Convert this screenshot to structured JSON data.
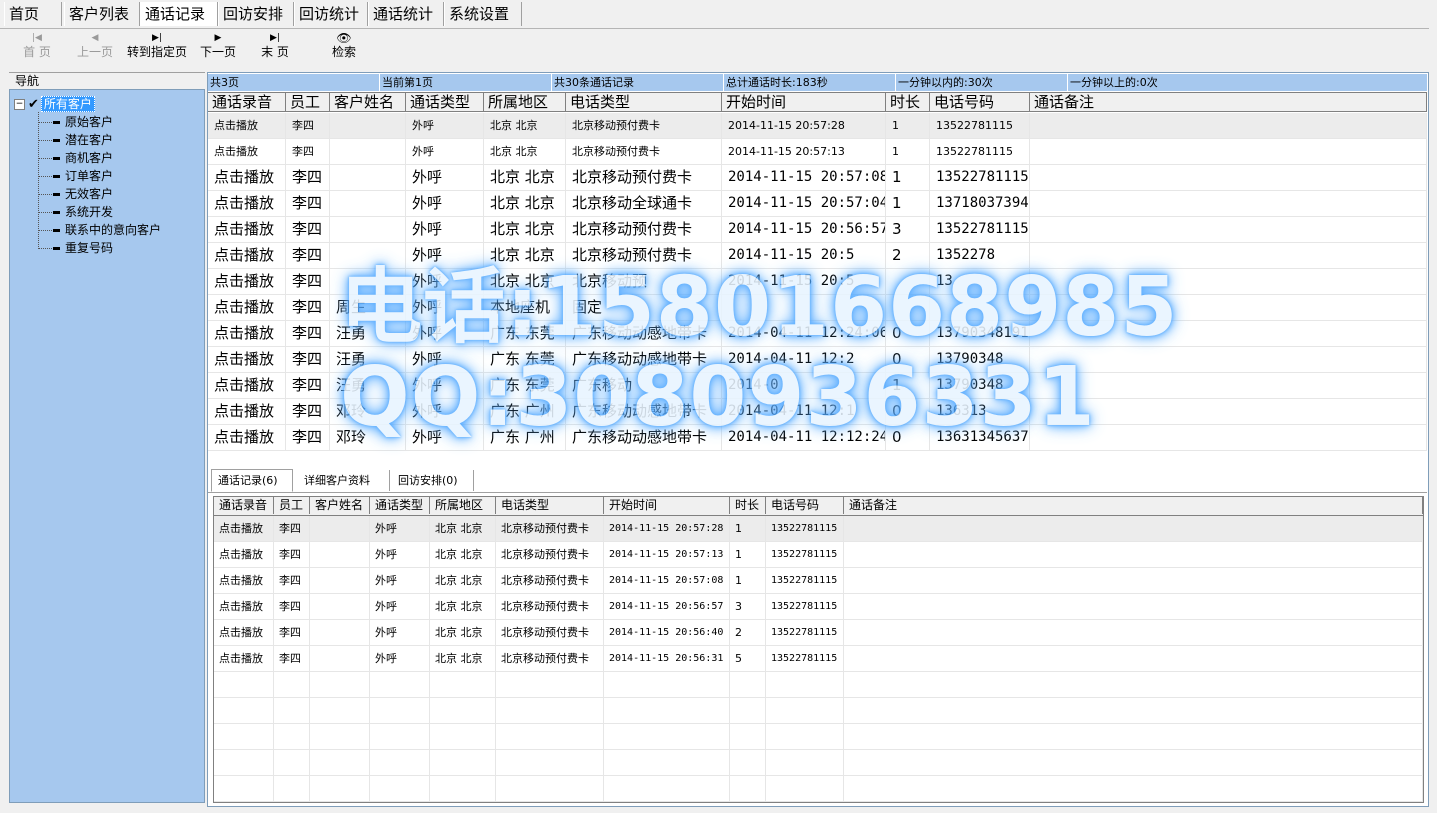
{
  "menu": {
    "tabs": [
      "首页",
      "客户列表",
      "通话记录",
      "回访安排",
      "回访统计",
      "通话统计",
      "系统设置"
    ]
  },
  "toolbar": {
    "first": "首  页",
    "prev": "上一页",
    "goto": "转到指定页",
    "next": "下一页",
    "last": "末  页",
    "search": "检索"
  },
  "nav": {
    "title": "导航",
    "root": "所有客户",
    "items": [
      "原始客户",
      "潜在客户",
      "商机客户",
      "订单客户",
      "无效客户",
      "系统开发",
      "联系中的意向客户",
      "重复号码"
    ]
  },
  "status": {
    "pages": "共3页",
    "current": "当前第1页",
    "records": "共30条通话记录",
    "duration": "总计通话时长:183秒",
    "under_min": "一分钟以内的:30次",
    "over_min": "一分钟以上的:0次"
  },
  "grid": {
    "headers": [
      "通话录音",
      "员工",
      "客户姓名",
      "通话类型",
      "所属地区",
      "电话类型",
      "开始时间",
      "时长",
      "电话号码",
      "通话备注"
    ],
    "rows": [
      [
        "点击播放",
        "李四",
        "",
        "外呼",
        "北京 北京",
        "北京移动预付费卡",
        "2014-11-15 20:57:28",
        "1",
        "13522781115",
        ""
      ],
      [
        "点击播放",
        "李四",
        "",
        "外呼",
        "北京 北京",
        "北京移动预付费卡",
        "2014-11-15 20:57:13",
        "1",
        "13522781115",
        ""
      ],
      [
        "点击播放",
        "李四",
        "",
        "外呼",
        "北京 北京",
        "北京移动预付费卡",
        "2014-11-15 20:57:08",
        "1",
        "13522781115",
        ""
      ],
      [
        "点击播放",
        "李四",
        "",
        "外呼",
        "北京 北京",
        "北京移动全球通卡",
        "2014-11-15 20:57:04",
        "1",
        "13718037394",
        ""
      ],
      [
        "点击播放",
        "李四",
        "",
        "外呼",
        "北京 北京",
        "北京移动预付费卡",
        "2014-11-15 20:56:57",
        "3",
        "13522781115",
        ""
      ],
      [
        "点击播放",
        "李四",
        "",
        "外呼",
        "北京 北京",
        "北京移动预付费卡",
        "2014-11-15 20:5",
        "2",
        "1352278",
        ""
      ],
      [
        "点击播放",
        "李四",
        "",
        "外呼",
        "北京 北京",
        "北京移动预",
        "2014-11-15 20:5",
        "",
        "13",
        ""
      ],
      [
        "点击播放",
        "李四",
        "周生",
        "外呼",
        "本地座机",
        "固定",
        "",
        "",
        "",
        ""
      ],
      [
        "点击播放",
        "李四",
        "汪勇",
        "外呼",
        "广东 东莞",
        "广东移动动感地带卡",
        "2014-04-11 12:24:06",
        "0",
        "13790348191",
        ""
      ],
      [
        "点击播放",
        "李四",
        "汪勇",
        "外呼",
        "广东 东莞",
        "广东移动动感地带卡",
        "2014-04-11 12:2",
        "0",
        "13790348",
        ""
      ],
      [
        "点击播放",
        "李四",
        "汪勇",
        "外呼",
        "广东 东莞",
        "广东移动",
        "2014-0",
        "1",
        "13790348",
        ""
      ],
      [
        "点击播放",
        "李四",
        "邓玲",
        "外呼",
        "广东 广州",
        "广东移动动感地带卡",
        "2014-04-11 12:1",
        "0",
        "136313",
        ""
      ],
      [
        "点击播放",
        "李四",
        "邓玲",
        "外呼",
        "广东 广州",
        "广东移动动感地带卡",
        "2014-04-11 12:12:24",
        "0",
        "13631345637",
        ""
      ]
    ]
  },
  "subtabs": [
    "通话记录(6)",
    "详细客户资料",
    "回访安排(0)"
  ],
  "subgrid": {
    "headers": [
      "通话录音",
      "员工",
      "客户姓名",
      "通话类型",
      "所属地区",
      "电话类型",
      "开始时间",
      "时长",
      "电话号码",
      "通话备注"
    ],
    "rows": [
      [
        "点击播放",
        "李四",
        "",
        "外呼",
        "北京 北京",
        "北京移动预付费卡",
        "2014-11-15 20:57:28",
        "1",
        "13522781115",
        ""
      ],
      [
        "点击播放",
        "李四",
        "",
        "外呼",
        "北京 北京",
        "北京移动预付费卡",
        "2014-11-15 20:57:13",
        "1",
        "13522781115",
        ""
      ],
      [
        "点击播放",
        "李四",
        "",
        "外呼",
        "北京 北京",
        "北京移动预付费卡",
        "2014-11-15 20:57:08",
        "1",
        "13522781115",
        ""
      ],
      [
        "点击播放",
        "李四",
        "",
        "外呼",
        "北京 北京",
        "北京移动预付费卡",
        "2014-11-15 20:56:57",
        "3",
        "13522781115",
        ""
      ],
      [
        "点击播放",
        "李四",
        "",
        "外呼",
        "北京 北京",
        "北京移动预付费卡",
        "2014-11-15 20:56:40",
        "2",
        "13522781115",
        ""
      ],
      [
        "点击播放",
        "李四",
        "",
        "外呼",
        "北京 北京",
        "北京移动预付费卡",
        "2014-11-15 20:56:31",
        "5",
        "13522781115",
        ""
      ]
    ]
  },
  "watermark": {
    "line1": "电话:15801668985",
    "line2": "QQ:3080936331"
  },
  "colors": {
    "nav_bg": "#a6c8ee",
    "selection": "#3399ff",
    "watermark_glow": "#4da6ff"
  }
}
